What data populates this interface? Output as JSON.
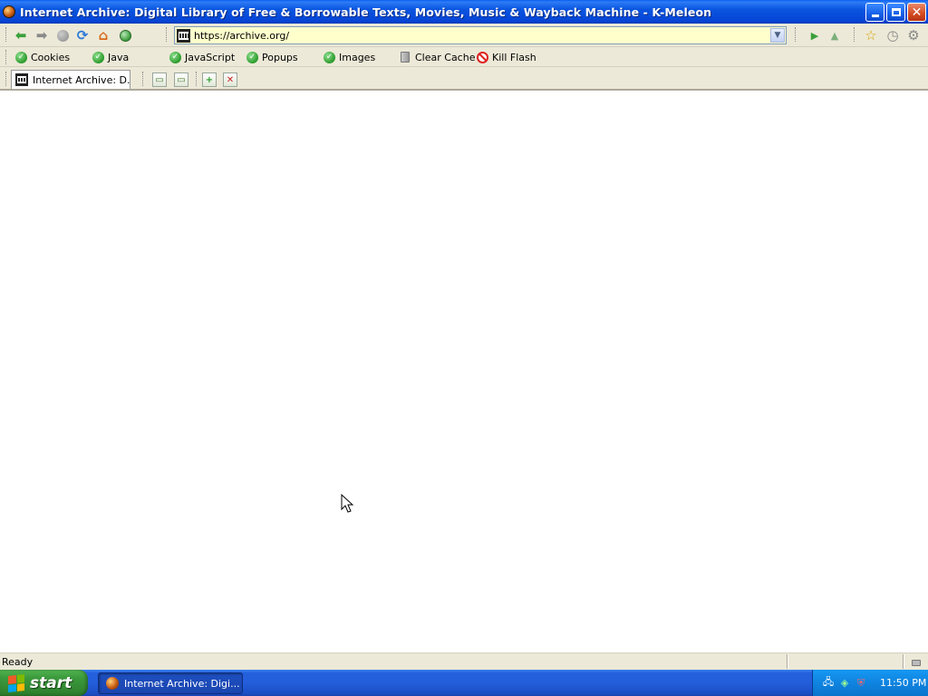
{
  "window": {
    "title": "Internet Archive: Digital Library of Free & Borrowable Texts, Movies, Music & Wayback Machine - K-Meleon"
  },
  "navbar": {
    "url": "https://archive.org/",
    "icons": [
      "back-icon",
      "forward-icon",
      "stop-icon",
      "reload-icon",
      "home-icon",
      "go-icon",
      "bookmark-star-icon",
      "history-icon",
      "settings-gear-icon"
    ]
  },
  "privacy_bar": {
    "items": [
      {
        "label": "Cookies",
        "state": "enabled"
      },
      {
        "label": "Java",
        "state": "enabled"
      },
      {
        "label": "JavaScript",
        "state": "enabled"
      },
      {
        "label": "Popups",
        "state": "enabled"
      },
      {
        "label": "Images",
        "state": "enabled"
      }
    ],
    "clear_cache": "Clear Cache",
    "kill_flash": "Kill Flash"
  },
  "tabs": {
    "items": [
      {
        "label": "Internet Archive: D..."
      }
    ]
  },
  "status": {
    "text": "Ready"
  },
  "taskbar": {
    "start_label": "start",
    "task_label": "Internet Archive: Digi...",
    "clock": "11:50 PM"
  },
  "colors": {
    "titlebar": "#0a55e0",
    "url_bg": "#ffffcc",
    "taskbar": "#245edb",
    "start": "#3c9a3c"
  }
}
